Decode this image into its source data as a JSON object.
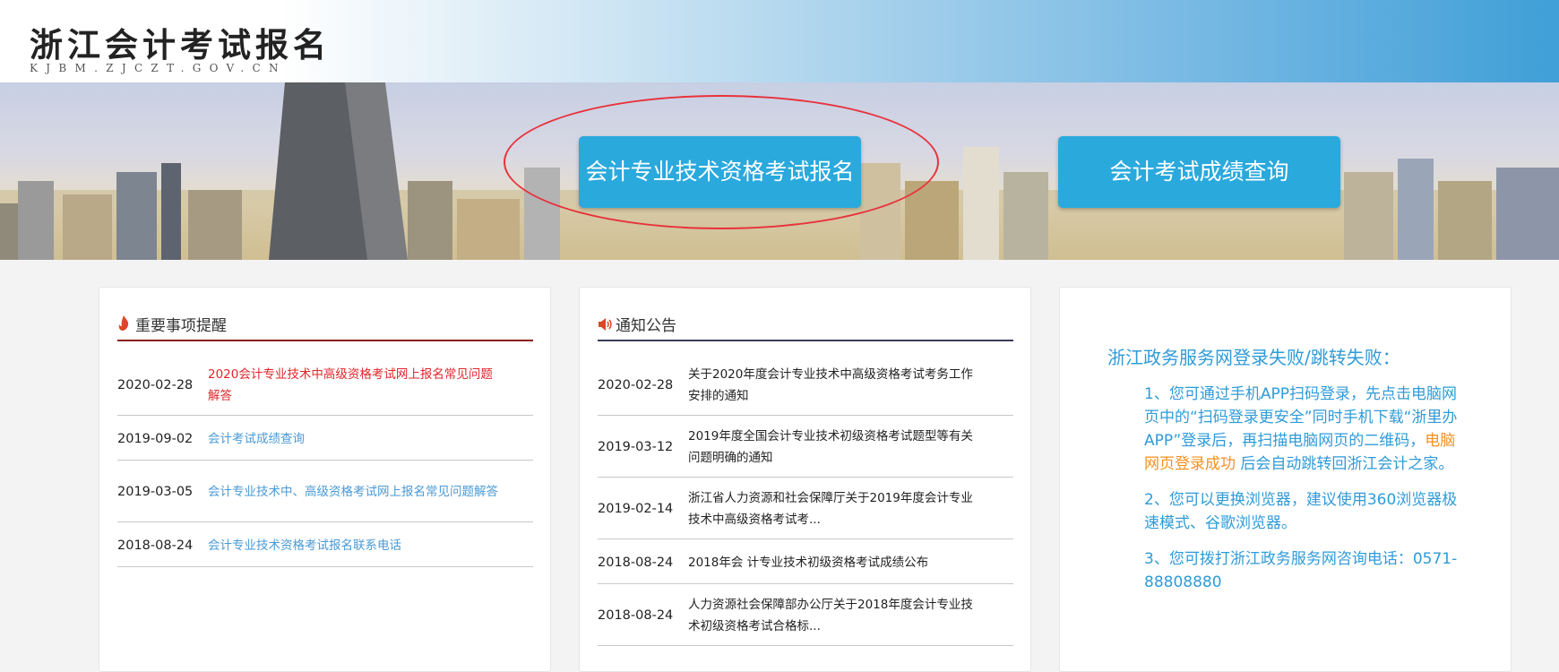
{
  "header": {
    "site_title": "浙江会计考试报名",
    "site_url": "KJBM.ZJCZT.GOV.CN"
  },
  "banner": {
    "register_button": "会计专业技术资格考试报名",
    "score_button": "会计考试成绩查询"
  },
  "important": {
    "title": "重要事项提醒",
    "icon": "flame-icon",
    "items": [
      {
        "date": "2020-02-28",
        "title": "2020会计专业技术中高级资格考试网上报名常见问题解答",
        "highlight": true
      },
      {
        "date": "2019-09-02",
        "title": "会计考试成绩查询"
      },
      {
        "date": "2019-03-05",
        "title": "会计专业技术中、高级资格考试网上报名常见问题解答"
      },
      {
        "date": "2018-08-24",
        "title": "会计专业技术资格考试报名联系电话"
      }
    ]
  },
  "notice": {
    "title": "通知公告",
    "icon": "speaker-icon",
    "items": [
      {
        "date": "2020-02-28",
        "title": "关于2020年度会计专业技术中高级资格考试考务工作安排的通知"
      },
      {
        "date": "2019-03-12",
        "title": "2019年度全国会计专业技术初级资格考试题型等有关问题明确的通知"
      },
      {
        "date": "2019-02-14",
        "title": "浙江省人力资源和社会保障厅关于2019年度会计专业技术中高级资格考试考..."
      },
      {
        "date": "2018-08-24",
        "title": "2018年会 计专业技术初级资格考试成绩公布"
      },
      {
        "date": "2018-08-24",
        "title": "人力资源社会保障部办公厅关于2018年度会计专业技术初级资格考试合格标..."
      }
    ]
  },
  "help": {
    "title": "浙江政务服务网登录失败/跳转失败：",
    "tip1_part1": "1、您可通过手机APP扫码登录，先点击电脑网页中的“扫码登录更安全”同时手机下载“浙里办APP”登录后，再扫描电脑网页的二维码，",
    "tip1_highlight": "电脑网页登录成功",
    "tip1_part2": " 后会自动跳转回浙江会计之家。",
    "tip2": "2、您可以更换浏览器，建议使用360浏览器极速模式、谷歌浏览器。",
    "tip3": "3、您可拨打浙江政务服务网咨询电话：0571-88808880"
  },
  "colors": {
    "button_blue": "#2aa9dd",
    "link_blue": "#4a9ad6",
    "alert_red": "#e0252b",
    "help_orange": "#f29222"
  }
}
